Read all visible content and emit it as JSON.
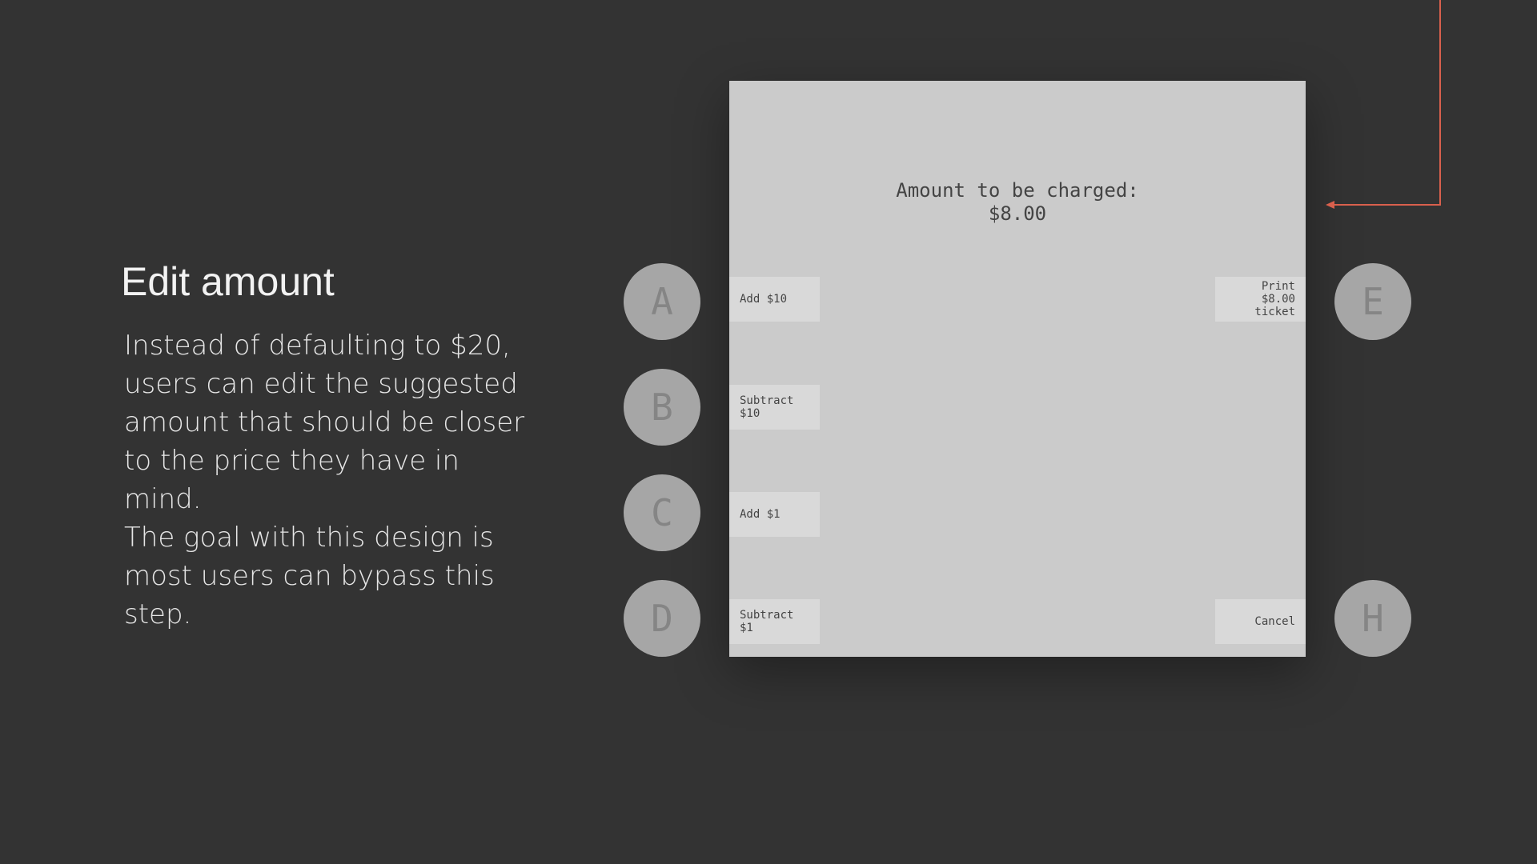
{
  "slide": {
    "heading": "Edit amount",
    "paragraphs": [
      "Instead of defaulting to $20, users can edit the suggested amount that should be closer to the price they have in mind.",
      "The goal with this design is most users can bypass this step."
    ]
  },
  "screen": {
    "amount_label": "Amount to be charged:",
    "amount_value": "$8.00",
    "buttons": {
      "add_10": "Add $10",
      "subtract_10": "Subtract $10",
      "add_1": "Add $1",
      "subtract_1": "Subtract $1",
      "print": "Print $8.00 ticket",
      "cancel": "Cancel"
    }
  },
  "keys": {
    "a": "A",
    "b": "B",
    "c": "C",
    "d": "D",
    "e": "E",
    "h": "H"
  },
  "colors": {
    "background": "#333333",
    "screen": "#cbcbcb",
    "button": "#d9d9d9",
    "key": "#a6a6a6",
    "connector": "#d9604d"
  }
}
